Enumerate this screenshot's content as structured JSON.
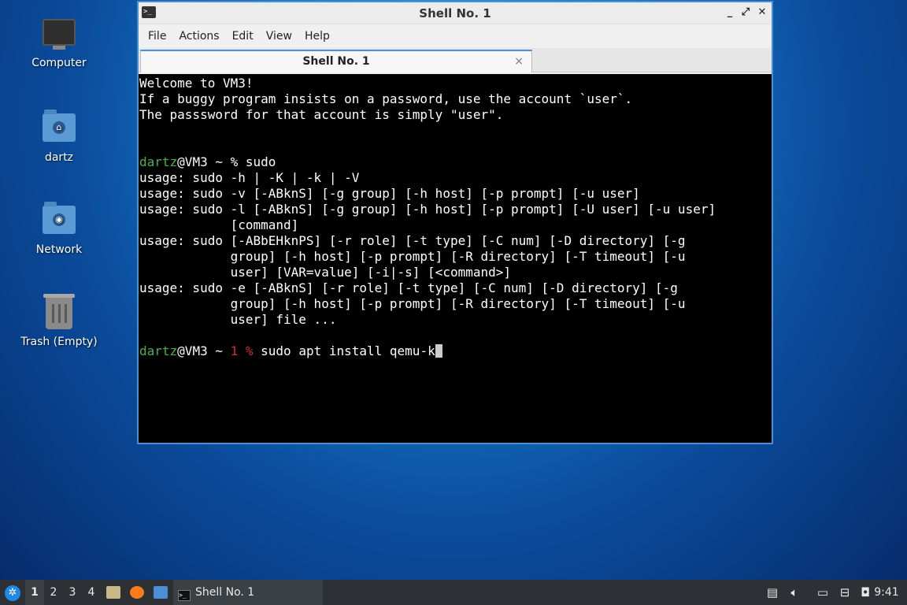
{
  "desktop": {
    "icons": [
      {
        "label": "Computer"
      },
      {
        "label": "dartz"
      },
      {
        "label": "Network"
      },
      {
        "label": "Trash (Empty)"
      }
    ]
  },
  "window": {
    "title": "Shell No. 1",
    "menu": [
      "File",
      "Actions",
      "Edit",
      "View",
      "Help"
    ],
    "tab_label": "Shell No. 1",
    "close_glyph": "×"
  },
  "terminal": {
    "welcome": [
      "Welcome to VM3!",
      "If a buggy program insists on a password, use the account `user`.",
      "The passsword for that account is simply \"user\"."
    ],
    "prompt1": {
      "user": "dartz",
      "rest": "@VM3 ~ % sudo"
    },
    "output": [
      "usage: sudo -h | -K | -k | -V",
      "usage: sudo -v [-ABknS] [-g group] [-h host] [-p prompt] [-u user]",
      "usage: sudo -l [-ABknS] [-g group] [-h host] [-p prompt] [-U user] [-u user]",
      "            [command]",
      "usage: sudo [-ABbEHknPS] [-r role] [-t type] [-C num] [-D directory] [-g",
      "            group] [-h host] [-p prompt] [-R directory] [-T timeout] [-u",
      "            user] [VAR=value] [-i|-s] [<command>]",
      "usage: sudo -e [-ABknS] [-r role] [-t type] [-C num] [-D directory] [-g",
      "            group] [-h host] [-p prompt] [-R directory] [-T timeout] [-u",
      "            user] file ..."
    ],
    "prompt2": {
      "user": "dartz",
      "host": "@VM3 ~ ",
      "status": "1 %",
      "command": " sudo apt install qemu-k"
    }
  },
  "taskbar": {
    "workspaces": [
      "1",
      "2",
      "3",
      "4"
    ],
    "active_workspace": "1",
    "task_label": "Shell No. 1",
    "clock": "9:41"
  },
  "colors": {
    "accent": "#4a90d9",
    "prompt_user": "#4caf50",
    "error_status": "#d32f2f"
  }
}
